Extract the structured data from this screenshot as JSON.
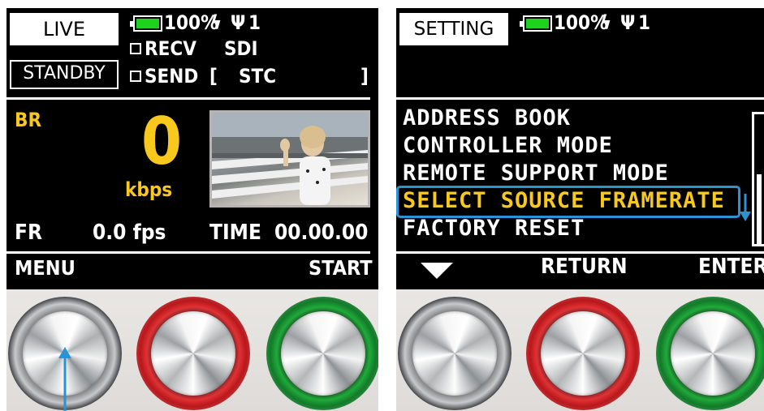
{
  "colors": {
    "accent_yellow": "#f8c81c",
    "highlight_blue": "#2b93d4",
    "battery_green": "#1ed31e"
  },
  "left": {
    "mode_label": "LIVE",
    "state_label": "STANDBY",
    "battery_text": "100%",
    "charging_icon": "lightning-icon",
    "signal_icon": "antenna-icon",
    "signal_text": "1",
    "recv_label": "RECV",
    "sdi_label": "SDI",
    "send_label": "SEND",
    "stc_open": "[",
    "stc_label": "STC",
    "stc_close": "]",
    "br_label": "BR",
    "bitrate_value": "0",
    "bitrate_unit": "kbps",
    "fr_label": "FR",
    "fps_value": "0.0 fps",
    "time_label": "TIME",
    "time_value": "00.00.00",
    "softkey_left": "MENU",
    "softkey_right": "START"
  },
  "right": {
    "mode_label": "SETTING",
    "battery_text": "100%",
    "charging_icon": "lightning-icon",
    "signal_icon": "antenna-icon",
    "signal_text": "1",
    "menu_items": [
      "ADDRESS BOOK",
      "CONTROLLER MODE",
      "REMOTE SUPPORT MODE",
      "SELECT SOURCE FRAMERATE",
      "FACTORY RESET"
    ],
    "selected_index": 3,
    "softkey_middle": "RETURN",
    "softkey_right": "ENTER"
  }
}
